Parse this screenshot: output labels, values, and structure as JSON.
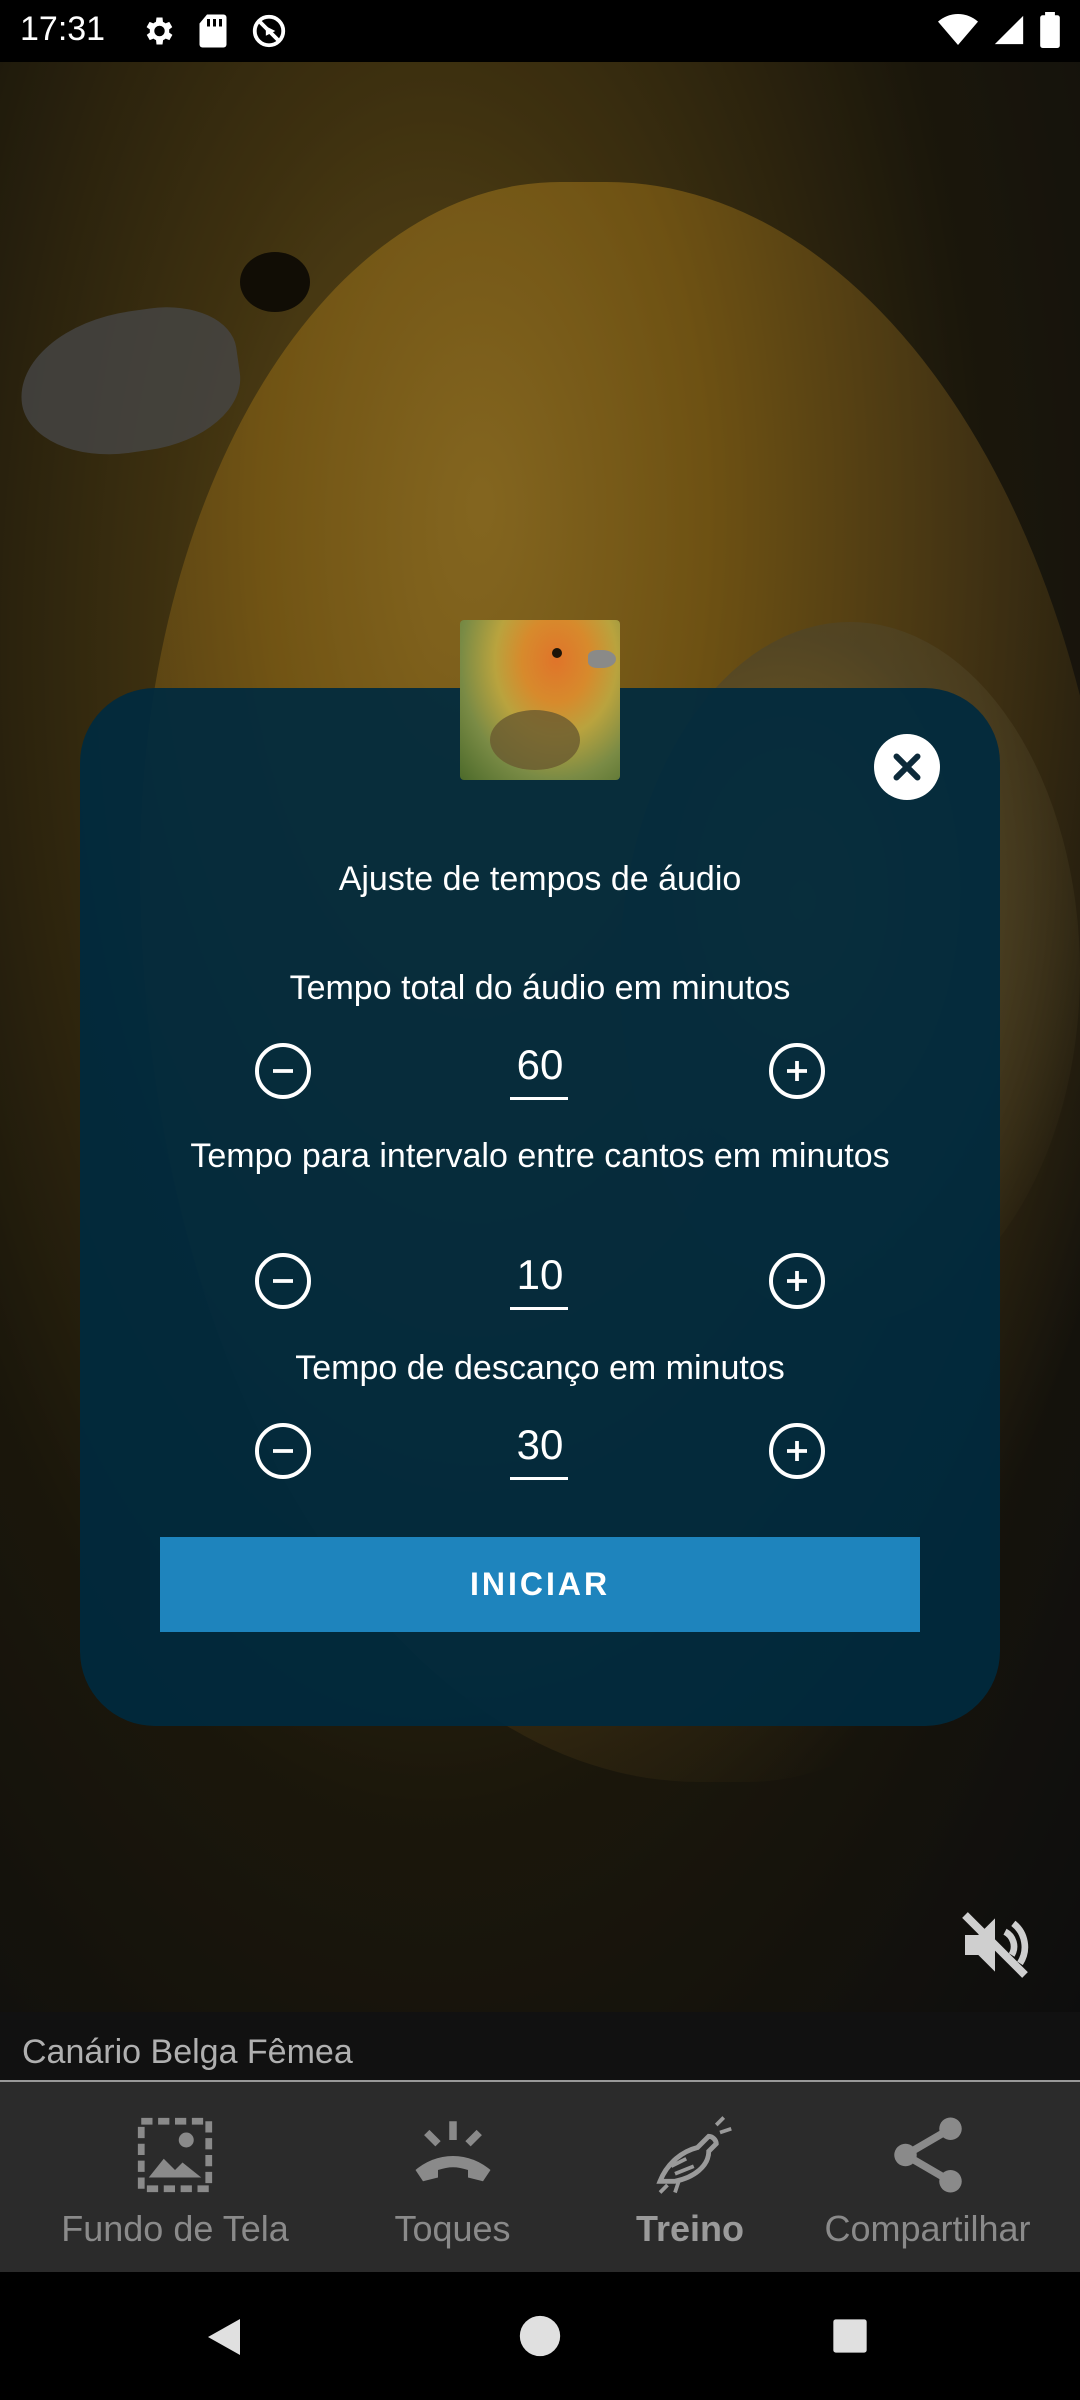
{
  "status_bar": {
    "time": "17:31"
  },
  "dialog": {
    "title": "Ajuste de tempos de áudio",
    "fields": [
      {
        "label": "Tempo total do áudio em minutos",
        "value": "60"
      },
      {
        "label": "Tempo para intervalo entre cantos em minutos",
        "value": "10"
      },
      {
        "label": "Tempo de descanço em minutos",
        "value": "30"
      }
    ],
    "start_label": "INICIAR"
  },
  "caption": "Canário Belga Fêmea",
  "bottom_nav": {
    "items": [
      {
        "label": "Fundo de Tela",
        "icon": "wallpaper-icon"
      },
      {
        "label": "Toques",
        "icon": "ringtone-icon"
      },
      {
        "label": "Treino",
        "icon": "bird-icon",
        "active": true
      },
      {
        "label": "Compartilhar",
        "icon": "share-icon"
      }
    ]
  },
  "colors": {
    "dialog_bg": "#002a3e",
    "button": "#1e84bd"
  }
}
